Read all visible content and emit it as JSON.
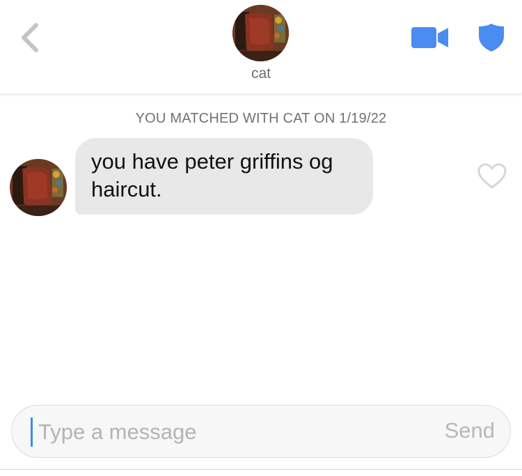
{
  "header": {
    "contact_name": "cat",
    "back_icon": "chevron-left-icon",
    "video_icon": "video-camera-icon",
    "safety_icon": "shield-icon",
    "accent_color": "#4a8cf0"
  },
  "conversation": {
    "match_banner": "YOU MATCHED WITH CAT ON 1/19/22",
    "messages": [
      {
        "sender": "cat",
        "text": "you have peter griffins og haircut.",
        "liked": false,
        "like_icon": "heart-outline-icon"
      }
    ]
  },
  "composer": {
    "placeholder": "Type a message",
    "value": "",
    "send_label": "Send"
  }
}
